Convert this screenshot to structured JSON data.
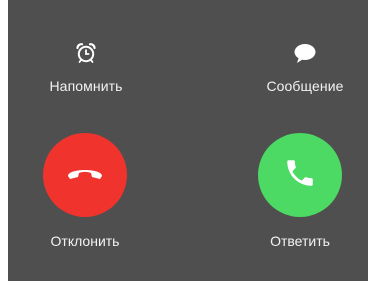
{
  "options": {
    "remind_label": "Напомнить",
    "message_label": "Сообщение",
    "remind_icon": "alarm-clock-icon",
    "message_icon": "speech-bubble-icon"
  },
  "call_actions": {
    "decline_label": "Отклонить",
    "accept_label": "Ответить",
    "decline_color": "#f0342d",
    "accept_color": "#4cd964",
    "decline_icon": "phone-hangup-icon",
    "accept_icon": "phone-icon"
  },
  "colors": {
    "background": "#4f4f4f",
    "label_text": "#f2f2f2"
  }
}
